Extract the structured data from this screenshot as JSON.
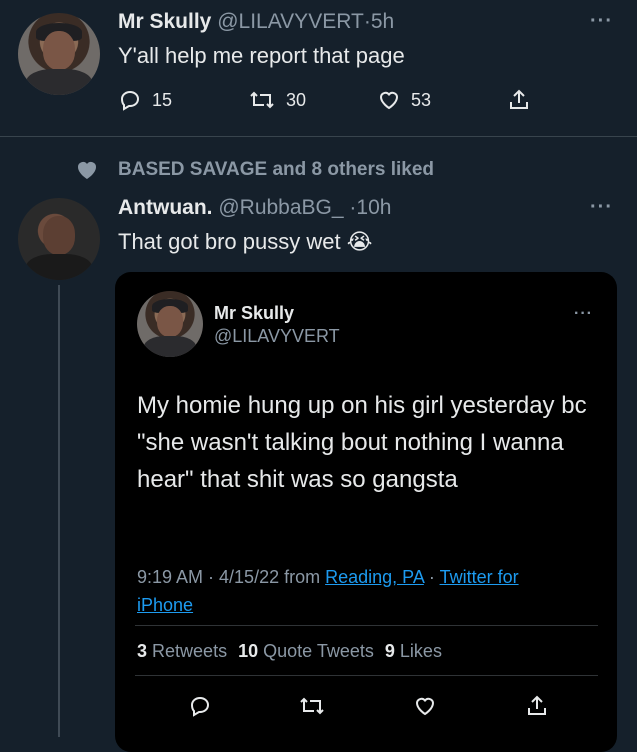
{
  "tweet1": {
    "display_name": "Mr Skully",
    "handle": "@LILAVYVERT",
    "sep": "·",
    "time": "5h",
    "text": "Y'all help me report that page",
    "replies": "15",
    "retweets": "30",
    "likes": "53",
    "more": "···"
  },
  "liked_banner": {
    "text": "BASED SAVAGE and 8 others liked"
  },
  "tweet2": {
    "display_name": "Antwuan.",
    "handle": "@RubbaBG_",
    "sep": "·",
    "time": "10h",
    "text": "That got bro pussy wet",
    "emoji": "😭",
    "more": "···"
  },
  "quoted": {
    "display_name": "Mr Skully",
    "handle": "@LILAVYVERT",
    "more": "···",
    "text": "My homie hung up on his girl yesterday bc \"she wasn't talking bout nothing I wanna hear\" that shit was so gangsta",
    "time": "9:19 AM · 4/15/22 from",
    "location": "Reading, PA",
    "sep": "·",
    "source_line1": "Twitter for",
    "source_line2": "iPhone",
    "retweets_count": "3",
    "retweets_label": "Retweets",
    "quotes_count": "10",
    "quotes_label": "Quote Tweets",
    "likes_count": "9",
    "likes_label": "Likes"
  },
  "colors": {
    "background": "#15202b",
    "quote_bg": "#000000",
    "link": "#1d9bf0",
    "muted": "#8b98a5"
  },
  "icons": [
    "reply-icon",
    "retweet-icon",
    "like-icon",
    "share-icon",
    "heart-filled-icon",
    "more-icon"
  ]
}
